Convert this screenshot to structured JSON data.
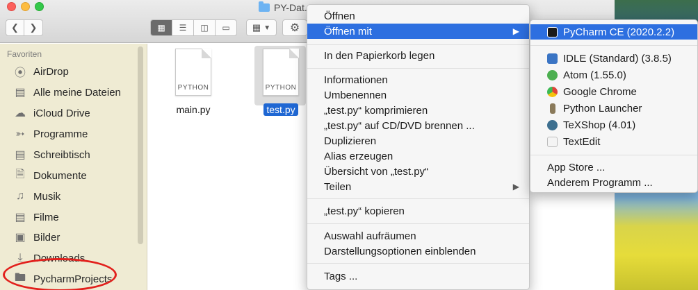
{
  "window": {
    "title": "PY-Dat..."
  },
  "toolbar": {
    "back_icon": "chevron-left-icon",
    "forward_icon": "chevron-right-icon",
    "view_icons": [
      "icon-view-icon",
      "list-view-icon",
      "column-view-icon",
      "cover-flow-icon"
    ],
    "arrange_icon": "arrange-icon",
    "action_icon": "gear-icon"
  },
  "sidebar": {
    "header": "Favoriten",
    "items": [
      {
        "label": "AirDrop",
        "icon": "airdrop-icon"
      },
      {
        "label": "Alle meine Dateien",
        "icon": "all-files-icon"
      },
      {
        "label": "iCloud Drive",
        "icon": "cloud-icon"
      },
      {
        "label": "Programme",
        "icon": "applications-icon"
      },
      {
        "label": "Schreibtisch",
        "icon": "desktop-icon"
      },
      {
        "label": "Dokumente",
        "icon": "documents-icon"
      },
      {
        "label": "Musik",
        "icon": "music-icon"
      },
      {
        "label": "Filme",
        "icon": "movies-icon"
      },
      {
        "label": "Bilder",
        "icon": "pictures-icon"
      },
      {
        "label": "Downloads",
        "icon": "downloads-icon"
      },
      {
        "label": "PycharmProjects",
        "icon": "folder-icon"
      }
    ]
  },
  "files": [
    {
      "name": "main.py",
      "type_label": "PYTHON",
      "selected": false
    },
    {
      "name": "test.py",
      "type_label": "PYTHON",
      "selected": true
    }
  ],
  "context_menu": {
    "items": [
      {
        "label": "Öffnen"
      },
      {
        "label": "Öffnen mit",
        "highlighted": true,
        "submenu": true
      },
      {
        "label": "In den Papierkorb legen"
      },
      {
        "label": "Informationen"
      },
      {
        "label": "Umbenennen"
      },
      {
        "label": "„test.py“ komprimieren"
      },
      {
        "label": "„test.py“ auf CD/DVD brennen ..."
      },
      {
        "label": "Duplizieren"
      },
      {
        "label": "Alias erzeugen"
      },
      {
        "label": "Übersicht von „test.py“"
      },
      {
        "label": "Teilen",
        "submenu": true
      },
      {
        "label": "„test.py“ kopieren"
      },
      {
        "label": "Auswahl aufräumen"
      },
      {
        "label": "Darstellungsoptionen einblenden"
      },
      {
        "label": "Tags ..."
      }
    ]
  },
  "open_with_submenu": {
    "items": [
      {
        "label": "PyCharm CE (2020.2.2)",
        "icon": "pycharm-icon",
        "color": "#1a1a1a",
        "highlighted": true
      },
      {
        "label": "IDLE (Standard) (3.8.5)",
        "icon": "idle-icon",
        "color": "#3a74c4"
      },
      {
        "label": "Atom (1.55.0)",
        "icon": "atom-icon",
        "color": "#4caf50"
      },
      {
        "label": "Google Chrome",
        "icon": "chrome-icon",
        "color": "#e0443a"
      },
      {
        "label": "Python Launcher",
        "icon": "python-launcher-icon",
        "color": "#8a7a5a"
      },
      {
        "label": "TeXShop (4.01)",
        "icon": "texshop-icon",
        "color": "#3d6f8f"
      },
      {
        "label": "TextEdit",
        "icon": "textedit-icon",
        "color": "#d8d8d8"
      },
      {
        "label": "App Store ..."
      },
      {
        "label": "Anderem Programm ..."
      }
    ]
  },
  "colors": {
    "highlight": "#2d6fe0",
    "selection": "#1f67d3",
    "annotation_circle": "#e2201c"
  }
}
